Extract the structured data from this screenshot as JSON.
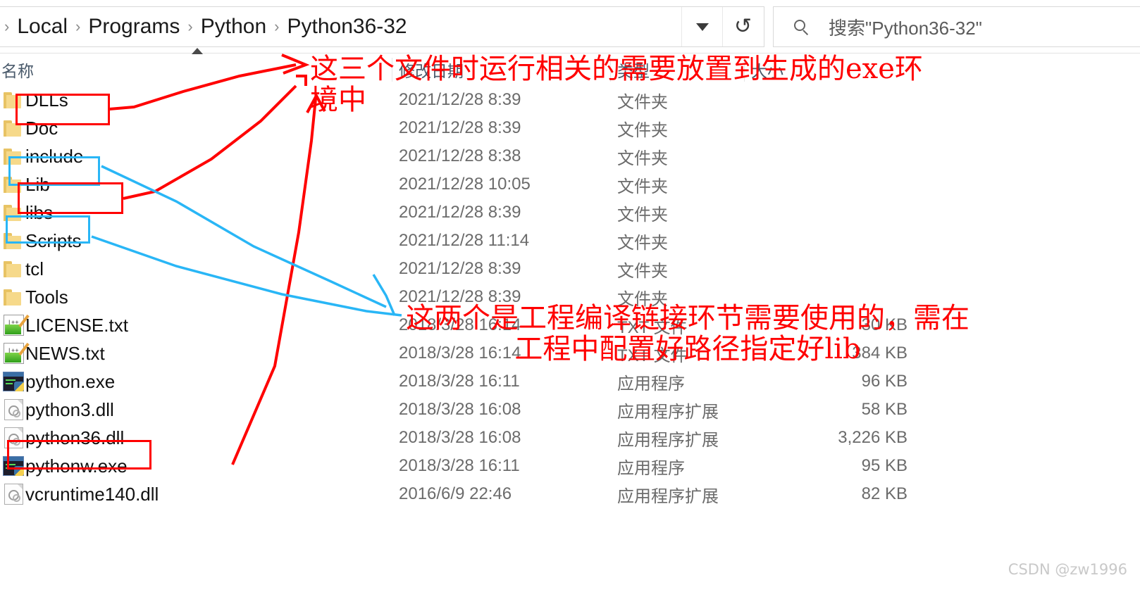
{
  "window": {
    "address": {
      "crumbs": [
        "Local",
        "Programs",
        "Python",
        "Python36-32"
      ],
      "separator": "›",
      "dropdown_icon": "chevron-down-icon",
      "refresh_icon": "refresh-icon"
    },
    "search": {
      "icon": "search-icon",
      "placeholder": "搜索\"Python36-32\""
    }
  },
  "columns": {
    "name": "名称",
    "date_modified": "修改日期",
    "type": "类型",
    "size": "大小",
    "sort_indicator": "sort-ascending-caret"
  },
  "files": [
    {
      "name": "DLLs",
      "date": "2021/12/28 8:39",
      "type": "文件夹",
      "size": "",
      "icon": "folder-icon"
    },
    {
      "name": "Doc",
      "date": "2021/12/28 8:39",
      "type": "文件夹",
      "size": "",
      "icon": "folder-icon"
    },
    {
      "name": "include",
      "date": "2021/12/28 8:38",
      "type": "文件夹",
      "size": "",
      "icon": "folder-icon"
    },
    {
      "name": "Lib",
      "date": "2021/12/28 10:05",
      "type": "文件夹",
      "size": "",
      "icon": "folder-icon"
    },
    {
      "name": "libs",
      "date": "2021/12/28 8:39",
      "type": "文件夹",
      "size": "",
      "icon": "folder-icon"
    },
    {
      "name": "Scripts",
      "date": "2021/12/28 11:14",
      "type": "文件夹",
      "size": "",
      "icon": "folder-icon"
    },
    {
      "name": "tcl",
      "date": "2021/12/28 8:39",
      "type": "文件夹",
      "size": "",
      "icon": "folder-icon"
    },
    {
      "name": "Tools",
      "date": "2021/12/28 8:39",
      "type": "文件夹",
      "size": "",
      "icon": "folder-icon"
    },
    {
      "name": "LICENSE.txt",
      "date": "2018/3/28 16:14",
      "type": "TXT 文件",
      "size": "30 KB",
      "icon": "text-file-icon"
    },
    {
      "name": "NEWS.txt",
      "date": "2018/3/28 16:14",
      "type": "TXT 文件",
      "size": "384 KB",
      "icon": "text-file-icon"
    },
    {
      "name": "python.exe",
      "date": "2018/3/28 16:11",
      "type": "应用程序",
      "size": "96 KB",
      "icon": "application-icon"
    },
    {
      "name": "python3.dll",
      "date": "2018/3/28 16:08",
      "type": "应用程序扩展",
      "size": "58 KB",
      "icon": "dll-file-icon"
    },
    {
      "name": "python36.dll",
      "date": "2018/3/28 16:08",
      "type": "应用程序扩展",
      "size": "3,226 KB",
      "icon": "dll-file-icon"
    },
    {
      "name": "pythonw.exe",
      "date": "2018/3/28 16:11",
      "type": "应用程序",
      "size": "95 KB",
      "icon": "application-icon"
    },
    {
      "name": "vcruntime140.dll",
      "date": "2016/6/9 22:46",
      "type": "应用程序扩展",
      "size": "82 KB",
      "icon": "dll-file-icon"
    }
  ],
  "annotations": {
    "red_color": "#ff0000",
    "blue_color": "#29b6f6",
    "top_note_line1": "这三个文件时运行相关的需要放置到生成的exe环",
    "top_note_line2": "境中",
    "bottom_note_line1": "这两个是工程编译链接环节需要使用的，需在",
    "bottom_note_line2": "工程中配置好路径指定好lib",
    "red_highlighted": [
      "DLLs",
      "Lib",
      "python36.dll"
    ],
    "blue_highlighted": [
      "include",
      "libs"
    ]
  },
  "watermark": "CSDN @zw1996"
}
